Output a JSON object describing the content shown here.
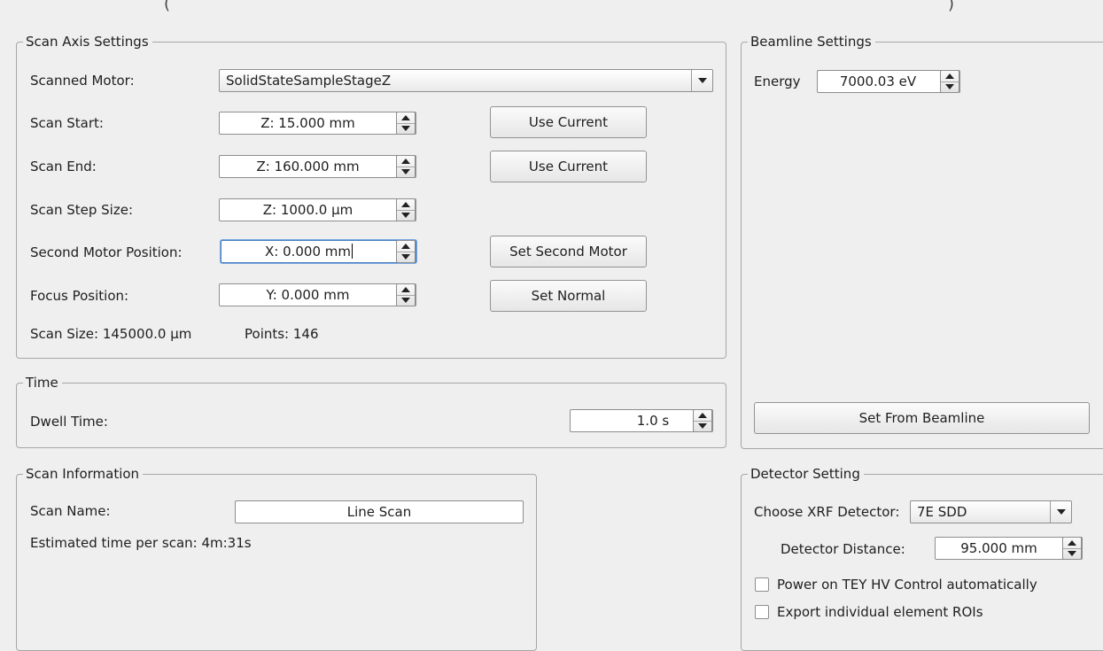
{
  "top_fragment": {
    "left": "(",
    "right": ")"
  },
  "scan_axis": {
    "title": "Scan Axis Settings",
    "scanned_motor_label": "Scanned Motor:",
    "scanned_motor_value": "SolidStateSampleStageZ",
    "scan_start_label": "Scan Start:",
    "scan_start_value": "Z: 15.000 mm",
    "scan_end_label": "Scan End:",
    "scan_end_value": "Z: 160.000 mm",
    "step_size_label": "Scan Step Size:",
    "step_size_value": "Z: 1000.0 µm",
    "second_motor_label": "Second Motor Position:",
    "second_motor_value": "X: 0.000 mm",
    "focus_label": "Focus Position:",
    "focus_value": "Y: 0.000 mm",
    "use_current_1": "Use Current",
    "use_current_2": "Use Current",
    "set_second_motor": "Set Second Motor",
    "set_normal": "Set Normal",
    "scan_size": "Scan Size: 145000.0 µm",
    "points": "Points: 146"
  },
  "time": {
    "title": "Time",
    "dwell_label": "Dwell Time:",
    "dwell_value": "1.0 s"
  },
  "beamline": {
    "title": "Beamline Settings",
    "energy_label": "Energy",
    "energy_value": "7000.03 eV",
    "set_from_beamline": "Set From Beamline"
  },
  "scan_info": {
    "title": "Scan Information",
    "scan_name_label": "Scan Name:",
    "scan_name_value": "Line Scan",
    "estimated_time": "Estimated time per scan: 4m:31s"
  },
  "detector": {
    "title": "Detector Setting",
    "choose_label": "Choose XRF Detector:",
    "choose_value": "7E SDD",
    "distance_label": "Detector Distance:",
    "distance_value": "95.000 mm",
    "power_tey": "Power on TEY HV Control automatically",
    "export_rois": "Export individual element ROIs"
  },
  "icons": {
    "combo_arrow": "chevron-down-icon",
    "spin_up": "spin-up-icon",
    "spin_down": "spin-down-icon"
  },
  "colors": {
    "background": "#efefef",
    "focus_border": "#4a7fc1"
  }
}
